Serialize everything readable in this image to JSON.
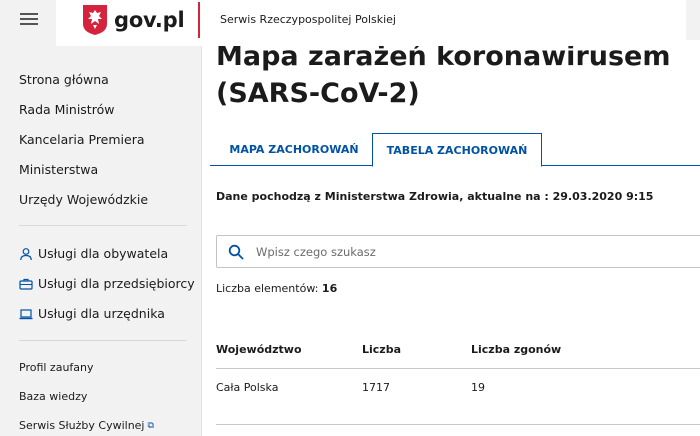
{
  "header": {
    "logo_text": "gov.pl",
    "title": "Serwis Rzeczypospolitej Polskiej",
    "accent_color": "#d5233d"
  },
  "sidebar": {
    "items": [
      {
        "label": "Strona główna"
      },
      {
        "label": "Rada Ministrów"
      },
      {
        "label": "Kancelaria Premiera"
      },
      {
        "label": "Ministerstwa"
      },
      {
        "label": "Urzędy Wojewódzkie"
      }
    ],
    "services": [
      {
        "label": "Usługi dla obywatela",
        "icon": "person-icon"
      },
      {
        "label": "Usługi dla przedsiębiorcy",
        "icon": "briefcase-icon"
      },
      {
        "label": "Usługi dla urzędnika",
        "icon": "laptop-icon"
      }
    ],
    "links": [
      {
        "label": "Profil zaufany"
      },
      {
        "label": "Baza wiedzy"
      },
      {
        "label": "Serwis Służby Cywilnej",
        "icon": "external-link-icon"
      }
    ]
  },
  "main": {
    "title": "Mapa zarażeń koronawirusem (SARS-CoV-2)",
    "tabs": [
      {
        "label": "MAPA ZACHOROWAŃ",
        "active": false
      },
      {
        "label": "TABELA ZACHOROWAŃ",
        "active": true
      }
    ],
    "source_text": "Dane pochodzą z Ministerstwa Zdrowia, aktualne na : 29.03.2020 9:15",
    "search": {
      "placeholder": "Wpisz czego szukasz",
      "value": ""
    },
    "count_label": "Liczba elementów:",
    "count_value": "16",
    "table": {
      "columns": [
        "Województwo",
        "Liczba",
        "Liczba zgonów"
      ],
      "rows": [
        [
          "Cała Polska",
          "1717",
          "19"
        ]
      ]
    },
    "accent_color": "#0052a5"
  }
}
